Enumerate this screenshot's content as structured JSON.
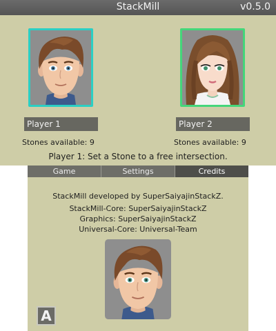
{
  "header": {
    "title": "StackMill",
    "version": "v0.5.0"
  },
  "players": [
    {
      "name": "Player 1",
      "stones": "Stones available: 9",
      "border_color": "#2bcfc4",
      "avatar": "male-avatar"
    },
    {
      "name": "Player 2",
      "stones": "Stones available: 9",
      "border_color": "#44d67a",
      "avatar": "female-avatar"
    }
  ],
  "status": "Player 1: Set a Stone to a free intersection.",
  "tabs": [
    {
      "label": "Game",
      "active": false
    },
    {
      "label": "Settings",
      "active": false
    },
    {
      "label": "Credits",
      "active": true
    }
  ],
  "credits": {
    "developed_by": "StackMill developed by SuperSaiyajinStackZ.",
    "core": "StackMill-Core: SuperSaiyajinStackZ",
    "graphics": "Graphics: SuperSaiyajinStackZ",
    "universal_core": "Universal-Core: Universal-Team",
    "avatar": "developer-avatar"
  },
  "a_button": {
    "label": "A"
  },
  "colors": {
    "background": "#cecda7",
    "panel": "#676760",
    "title_bar": "#5f5f5f"
  }
}
